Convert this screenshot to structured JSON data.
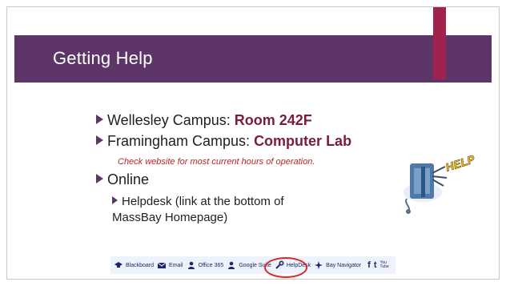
{
  "slide": {
    "title": "Getting Help",
    "bullets": [
      {
        "prefix": "Wellesley Campus: ",
        "highlight": "Room 242F"
      },
      {
        "prefix": "Framingham Campus: ",
        "highlight": "Computer Lab"
      },
      {
        "text": "Online"
      },
      {
        "text": "Helpdesk (link at the bottom of MassBay Homepage)"
      }
    ],
    "note": "Check website for most current hours of operation.",
    "clipart_text": "HELP"
  },
  "footer": {
    "items": [
      {
        "label": "Blackboard",
        "icon": "graduation-cap-icon"
      },
      {
        "label": "Email",
        "icon": "envelope-icon"
      },
      {
        "label": "Office 365",
        "icon": "user-icon"
      },
      {
        "label": "Google Suite",
        "icon": "user-icon"
      },
      {
        "label": "HelpDesk",
        "icon": "wrench-icon"
      },
      {
        "label": "Bay Navigator",
        "icon": "compass-icon"
      }
    ],
    "social": [
      {
        "glyph": "f",
        "icon": "facebook-icon"
      },
      {
        "glyph": "t",
        "icon": "twitter-icon"
      },
      {
        "glyph": "You Tube",
        "icon": "youtube-icon"
      }
    ]
  },
  "colors": {
    "header": "#5e3569",
    "accent": "#a1234d",
    "highlight": "#7b1c3f",
    "note": "#c32127",
    "circle": "#d62a2a"
  }
}
